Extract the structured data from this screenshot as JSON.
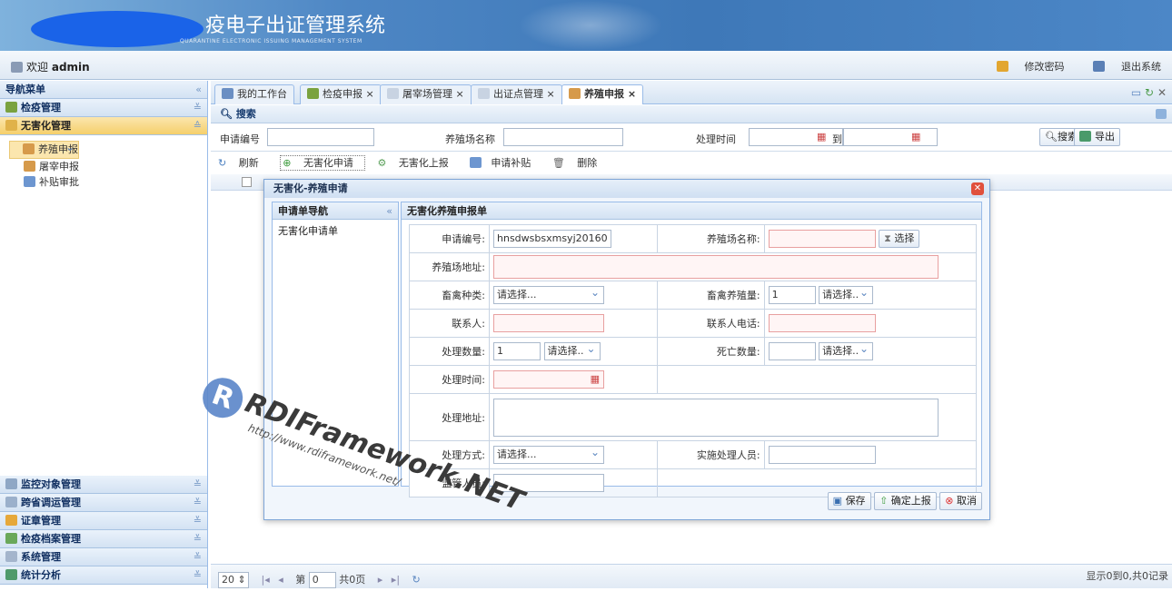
{
  "banner": {
    "title": "疫电子出证管理系统",
    "subtitle": "QUARANTINE ELECTRONIC ISSUING MANAGEMENT SYSTEM"
  },
  "userbar": {
    "welcome": "欢迎",
    "user": "admin",
    "change_pwd": "修改密码",
    "logout": "退出系统"
  },
  "sidebar": {
    "title": "导航菜单",
    "groups_top": [
      {
        "label": "检疫管理"
      },
      {
        "label": "无害化管理"
      }
    ],
    "items": [
      {
        "label": "养殖申报"
      },
      {
        "label": "屠宰申报"
      },
      {
        "label": "补贴审批"
      }
    ],
    "groups_bottom": [
      {
        "label": "监控对象管理"
      },
      {
        "label": "跨省调运管理"
      },
      {
        "label": "证章管理"
      },
      {
        "label": "检疫档案管理"
      },
      {
        "label": "系统管理"
      },
      {
        "label": "统计分析"
      }
    ]
  },
  "tabs": [
    {
      "label": "我的工作台"
    },
    {
      "label": "检疫申报"
    },
    {
      "label": "屠宰场管理"
    },
    {
      "label": "出证点管理"
    },
    {
      "label": "养殖申报"
    }
  ],
  "search": {
    "header": "搜索",
    "apply_no_label": "申请编号",
    "farm_name_label": "养殖场名称",
    "time_label": "处理时间",
    "to": "到",
    "search_btn": "搜索",
    "export_btn": "导出"
  },
  "toolbar": {
    "refresh": "刷新",
    "apply": "无害化申请",
    "report": "无害化上报",
    "subsidy": "申请补贴",
    "delete": "删除"
  },
  "pager": {
    "page_size": "20",
    "page_prefix": "第",
    "page_value": "0",
    "page_total": "共0页",
    "info": "显示0到0,共0记录"
  },
  "dialog": {
    "title": "无害化-养殖申请",
    "nav_title": "申请单导航",
    "nav_item": "无害化申请单",
    "form_title": "无害化养殖申报单",
    "fields": {
      "apply_no_label": "申请编号:",
      "apply_no_value": "hnsdwsbsxmsyj20160",
      "farm_name_label": "养殖场名称:",
      "choose_btn": "选择",
      "farm_addr_label": "养殖场地址:",
      "species_label": "畜禽种类:",
      "species_value": "请选择...",
      "stock_label": "畜禽养殖量:",
      "stock_value": "1",
      "stock_unit": "请选择..",
      "contact_label": "联系人:",
      "phone_label": "联系人电话:",
      "qty_label": "处理数量:",
      "qty_value": "1",
      "qty_unit": "请选择..",
      "dead_label": "死亡数量:",
      "dead_unit": "请选择..",
      "time_label": "处理时间:",
      "addr_label": "处理地址:",
      "method_label": "处理方式:",
      "method_value": "请选择...",
      "staff_label": "实施处理人员:",
      "supervisor_label": "监管人员:"
    },
    "save": "保存",
    "confirm": "确定上报",
    "cancel": "取消"
  },
  "watermark": {
    "brand": "RDIFramework.NET",
    "url": "http://www.rdiframework.net/"
  }
}
